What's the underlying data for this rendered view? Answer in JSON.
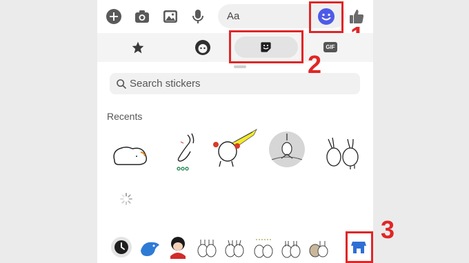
{
  "composer": {
    "message_placeholder": "Aa",
    "icons": [
      "add-icon",
      "camera-icon",
      "gallery-icon",
      "microphone-icon",
      "emoji-icon",
      "thumbs-up-icon"
    ]
  },
  "tabs": {
    "items": [
      "favorites",
      "avatar",
      "stickers",
      "gif"
    ],
    "gif_label": "GIF",
    "active": "stickers"
  },
  "search": {
    "placeholder": "Search stickers"
  },
  "recents": {
    "title": "Recents"
  },
  "annotations": {
    "one": "1",
    "two": "2",
    "three": "3"
  },
  "colors": {
    "accent": "#4f5be8",
    "annotation": "#e02626"
  }
}
